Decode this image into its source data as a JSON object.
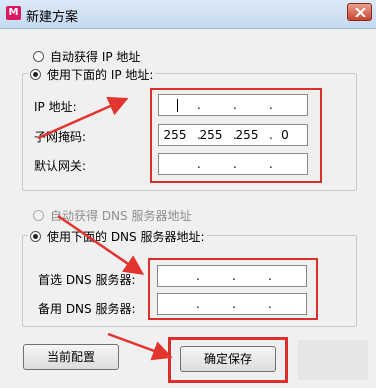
{
  "window": {
    "title": "新建方案"
  },
  "ip": {
    "auto_label": "自动获得 IP 地址",
    "manual_label": "使用下面的 IP 地址:",
    "address_label": "IP 地址:",
    "address": [
      "",
      "",
      "",
      ""
    ],
    "subnet_label": "子网掩码:",
    "subnet": [
      "255",
      "255",
      "255",
      "0"
    ],
    "gateway_label": "默认网关:",
    "gateway": [
      "",
      "",
      "",
      ""
    ]
  },
  "dns": {
    "auto_label": "自动获得 DNS 服务器地址",
    "manual_label": "使用下面的 DNS 服务器地址:",
    "preferred_label": "首选 DNS 服务器:",
    "preferred": [
      "",
      "",
      "",
      ""
    ],
    "alternate_label": "备用 DNS 服务器:",
    "alternate": [
      "",
      "",
      "",
      ""
    ]
  },
  "buttons": {
    "current_config": "当前配置",
    "save": "确定保存"
  },
  "colors": {
    "highlight": "#d9302c",
    "accent": "#3a6ea5"
  }
}
